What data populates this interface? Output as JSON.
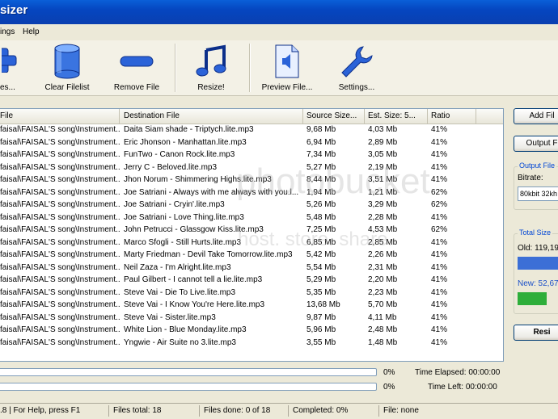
{
  "window": {
    "title": "sizer"
  },
  "menu": {
    "items": [
      "ings",
      "Help"
    ]
  },
  "toolbar": {
    "add_files": "es...",
    "clear_filelist": "Clear Filelist",
    "remove_file": "Remove File",
    "resize": "Resize!",
    "preview_file": "Preview File...",
    "settings": "Settings..."
  },
  "table": {
    "columns": [
      "File",
      "Destination File",
      "Source Size...",
      "Est. Size: 5...",
      "Ratio"
    ],
    "rows": [
      [
        "faisal\\FAISAL'S song\\Instrument...",
        "Daita Siam shade - Triptych.lite.mp3",
        "9,68 Mb",
        "4,03 Mb",
        "41%"
      ],
      [
        "faisal\\FAISAL'S song\\Instrument...",
        "Eric Jhonson - Manhattan.lite.mp3",
        "6,94 Mb",
        "2,89 Mb",
        "41%"
      ],
      [
        "faisal\\FAISAL'S song\\Instrument...",
        "FunTwo - Canon Rock.lite.mp3",
        "7,34 Mb",
        "3,05 Mb",
        "41%"
      ],
      [
        "faisal\\FAISAL'S song\\Instrument...",
        "Jerry C - Beloved.lite.mp3",
        "5,27 Mb",
        "2,19 Mb",
        "41%"
      ],
      [
        "faisal\\FAISAL'S song\\Instrument...",
        "Jhon Norum - Shimmering Highs.lite.mp3",
        "8,44 Mb",
        "3,51 Mb",
        "41%"
      ],
      [
        "faisal\\FAISAL'S song\\Instrument...",
        "Joe Satriani - Always with me always with you.l...",
        "1,94 Mb",
        "1,21 Mb",
        "62%"
      ],
      [
        "faisal\\FAISAL'S song\\Instrument...",
        "Joe Satriani - Cryin'.lite.mp3",
        "5,26 Mb",
        "3,29 Mb",
        "62%"
      ],
      [
        "faisal\\FAISAL'S song\\Instrument...",
        "Joe Satriani - Love Thing.lite.mp3",
        "5,48 Mb",
        "2,28 Mb",
        "41%"
      ],
      [
        "faisal\\FAISAL'S song\\Instrument...",
        "John Petrucci - Glassgow Kiss.lite.mp3",
        "7,25 Mb",
        "4,53 Mb",
        "62%"
      ],
      [
        "faisal\\FAISAL'S song\\Instrument...",
        "Marco Sfogli - Still Hurts.lite.mp3",
        "6,85 Mb",
        "2,85 Mb",
        "41%"
      ],
      [
        "faisal\\FAISAL'S song\\Instrument...",
        "Marty Friedman - Devil Take Tomorrow.lite.mp3",
        "5,42 Mb",
        "2,26 Mb",
        "41%"
      ],
      [
        "faisal\\FAISAL'S song\\Instrument...",
        "Neil Zaza - I'm Alright.lite.mp3",
        "5,54 Mb",
        "2,31 Mb",
        "41%"
      ],
      [
        "faisal\\FAISAL'S song\\Instrument...",
        "Paul Gilbert - I cannot tell a lie.lite.mp3",
        "5,29 Mb",
        "2,20 Mb",
        "41%"
      ],
      [
        "faisal\\FAISAL'S song\\Instrument...",
        "Steve Vai - Die To Live.lite.mp3",
        "5,35 Mb",
        "2,23 Mb",
        "41%"
      ],
      [
        "faisal\\FAISAL'S song\\Instrument...",
        "Steve Vai - I Know You're Here.lite.mp3",
        "13,68 Mb",
        "5,70 Mb",
        "41%"
      ],
      [
        "faisal\\FAISAL'S song\\Instrument...",
        "Steve Vai - Sister.lite.mp3",
        "9,87 Mb",
        "4,11 Mb",
        "41%"
      ],
      [
        "faisal\\FAISAL'S song\\Instrument...",
        "White Lion - Blue Monday.lite.mp3",
        "5,96 Mb",
        "2,48 Mb",
        "41%"
      ],
      [
        "faisal\\FAISAL'S song\\Instrument...",
        "Yngwie - Air Suite no 3.lite.mp3",
        "3,55 Mb",
        "1,48 Mb",
        "41%"
      ]
    ]
  },
  "right_panel": {
    "add_button": "Add Fil",
    "output_button": "Output F",
    "output_group_title": "Output File",
    "bitrate_label": "Bitrate:",
    "bitrate_value": "80kbit 32kh",
    "total_size_title": "Total Size",
    "old_label": "Old: 119,19",
    "new_label": "New: 52,67",
    "old_bar_color": "#3c6fd6",
    "new_bar_color": "#2eae3a",
    "resize_button": "Resi"
  },
  "progress": {
    "file_percent_text": "0%",
    "total_percent_text": "0%",
    "file_percent": 0,
    "total_percent": 0,
    "time_elapsed": "Time Elapsed: 00:00:00",
    "time_left": "Time Left: 00:00:00"
  },
  "statusbar": {
    "help": ".8 | For Help, press F1",
    "files_total": "Files total: 18",
    "files_done": "Files done: 0 of 18",
    "completed": "Completed:  0%",
    "file": "File: none"
  }
}
